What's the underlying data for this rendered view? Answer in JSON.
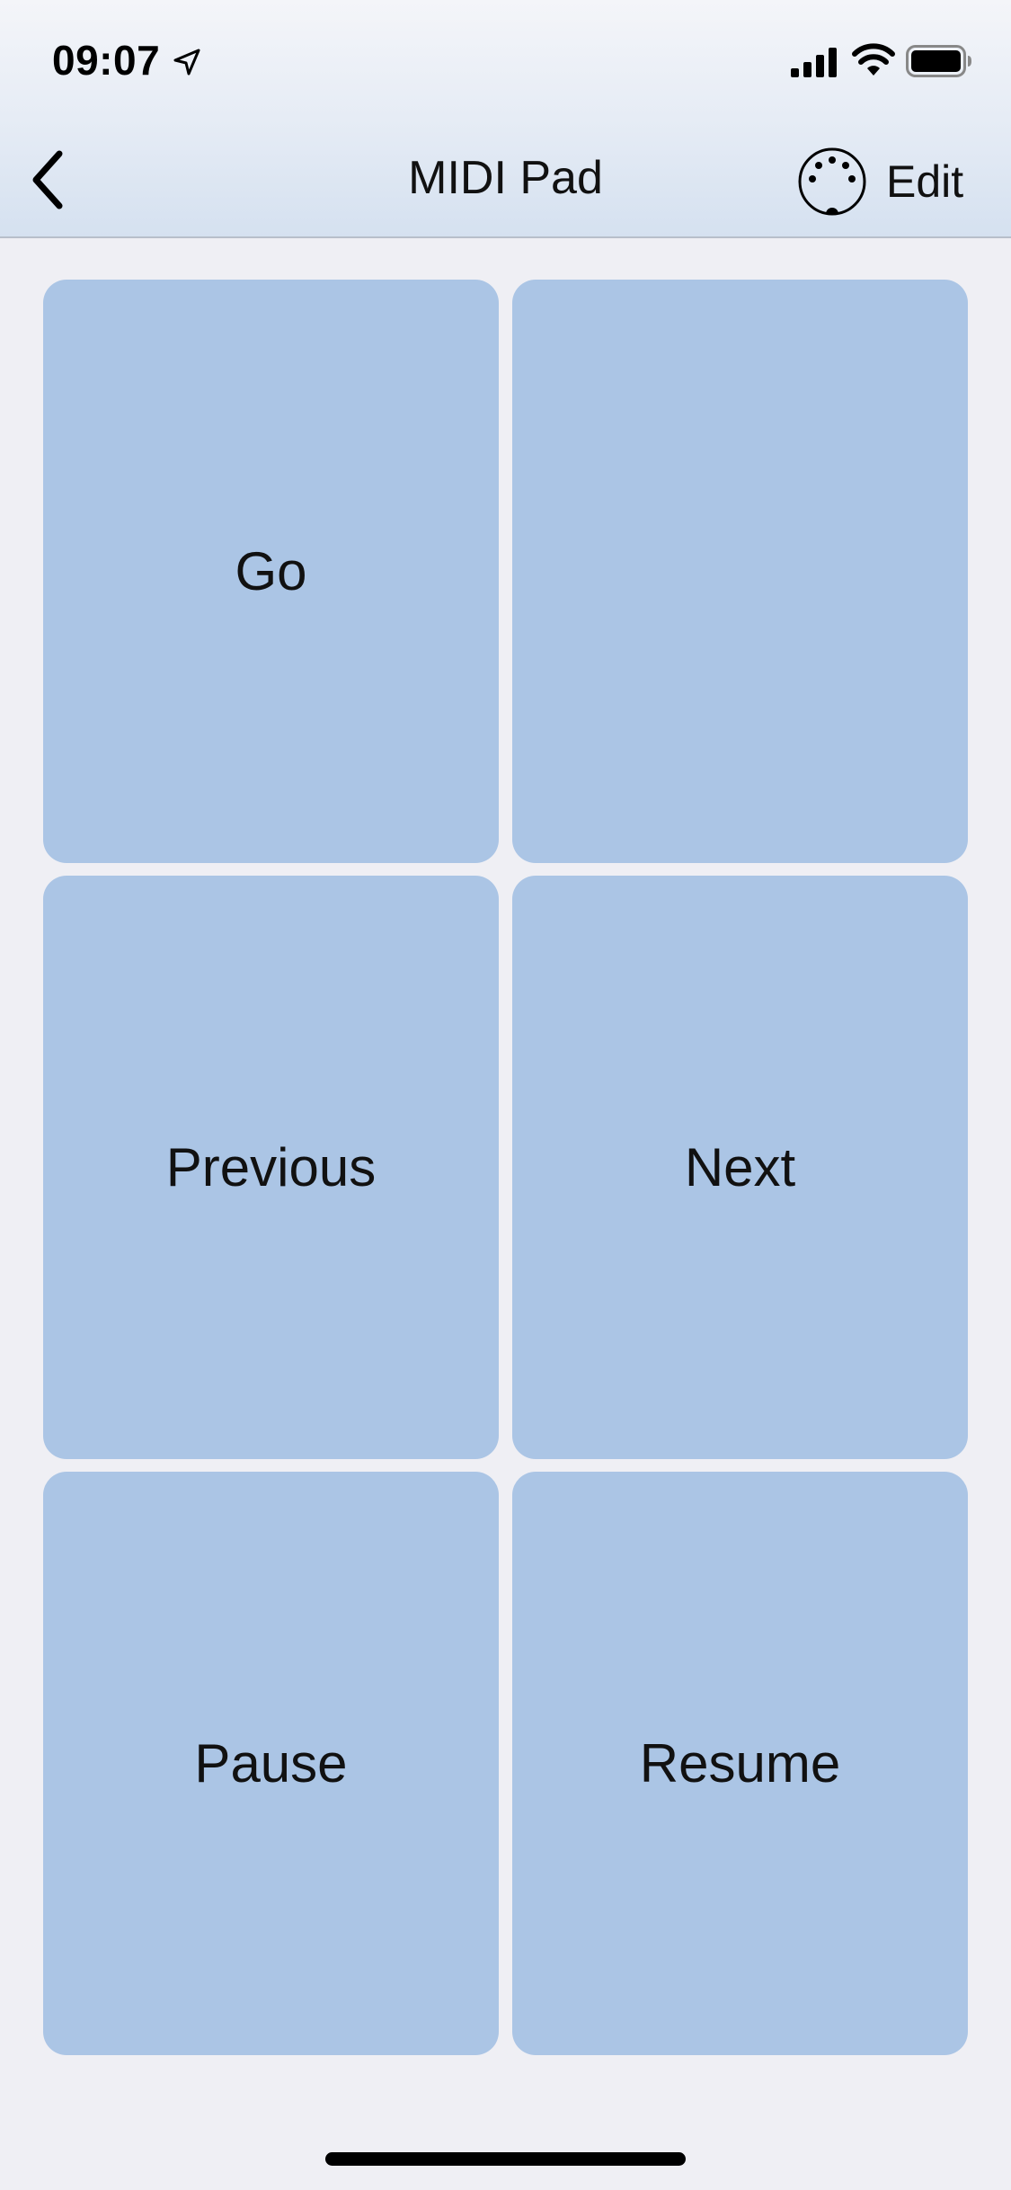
{
  "status_bar": {
    "time": "09:07"
  },
  "nav": {
    "title": "MIDI Pad",
    "edit_label": "Edit"
  },
  "pads": [
    {
      "label": "Go"
    },
    {
      "label": ""
    },
    {
      "label": "Previous"
    },
    {
      "label": "Next"
    },
    {
      "label": "Pause"
    },
    {
      "label": "Resume"
    }
  ],
  "icons": {
    "back": "chevron-left-icon",
    "midi": "midi-connector-icon",
    "location": "location-arrow-icon",
    "signal": "cellular-signal-icon",
    "wifi": "wifi-icon",
    "battery": "battery-icon"
  },
  "colors": {
    "pad": "#abc5e5",
    "background": "#efeff4",
    "header_top": "#f4f5f9",
    "header_bottom": "#d5e1f0"
  }
}
